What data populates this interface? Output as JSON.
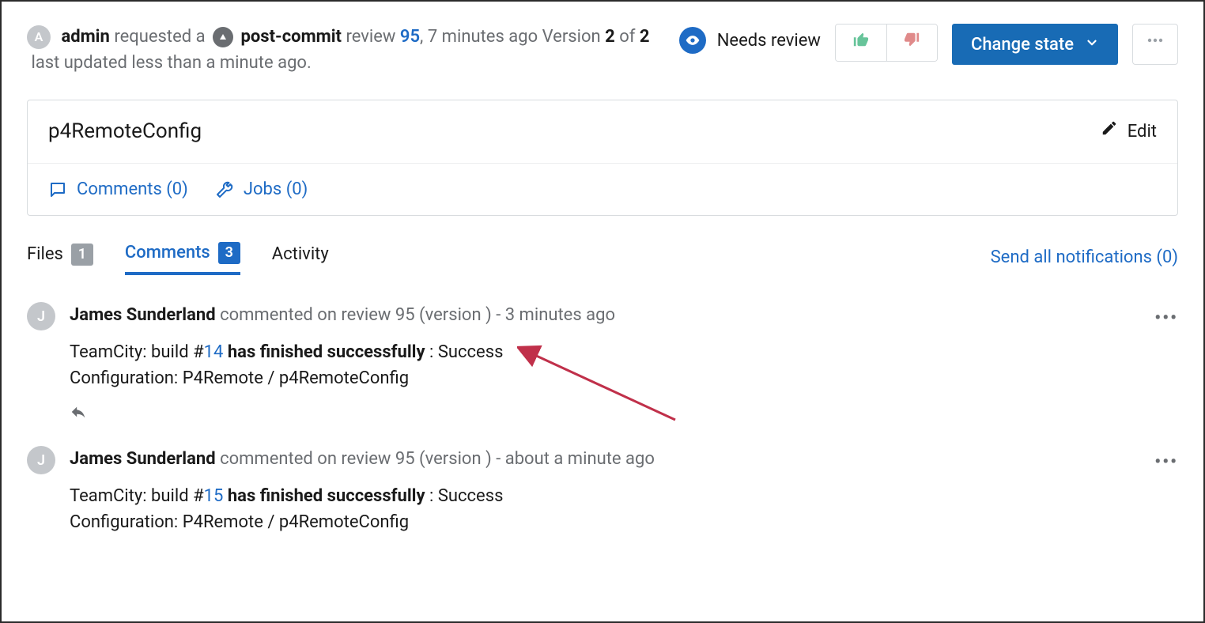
{
  "header": {
    "avatar_initial": "A",
    "requester": "admin",
    "requested_a": "requested a",
    "badge_icon": "chevron-up",
    "review_type": "post-commit",
    "review_label": "review",
    "review_id": "95",
    "comma": ",",
    "relative_time": "7 minutes ago",
    "version_label": "Version",
    "version_current": "2",
    "version_of": "of",
    "version_total": "2",
    "updated_text": "last updated less than a minute ago."
  },
  "status": {
    "label": "Needs review"
  },
  "actions": {
    "change_state": "Change state"
  },
  "title": {
    "text": "p4RemoteConfig",
    "edit_label": "Edit"
  },
  "subtabs": {
    "comments_label": "Comments (0)",
    "jobs_label": "Jobs (0)"
  },
  "tabs": {
    "files_label": "Files",
    "files_count": "1",
    "comments_label": "Comments",
    "comments_count": "3",
    "activity_label": "Activity",
    "send_notifications_label": "Send all notifications (0)"
  },
  "comments": [
    {
      "avatar_initial": "J",
      "author": "James Sunderland",
      "meta_text": "commented on review 95 (version ) - 3 minutes ago",
      "line1_prefix": "TeamCity: build #",
      "build_number": "14",
      "line1_bold": " has finished successfully",
      "line1_suffix": " : Success",
      "line2": "Configuration: P4Remote / p4RemoteConfig"
    },
    {
      "avatar_initial": "J",
      "author": "James Sunderland",
      "meta_text": "commented on review 95 (version ) - about a minute ago",
      "line1_prefix": "TeamCity: build #",
      "build_number": "15",
      "line1_bold": " has finished successfully",
      "line1_suffix": " : Success",
      "line2": "Configuration: P4Remote / p4RemoteConfig"
    }
  ]
}
